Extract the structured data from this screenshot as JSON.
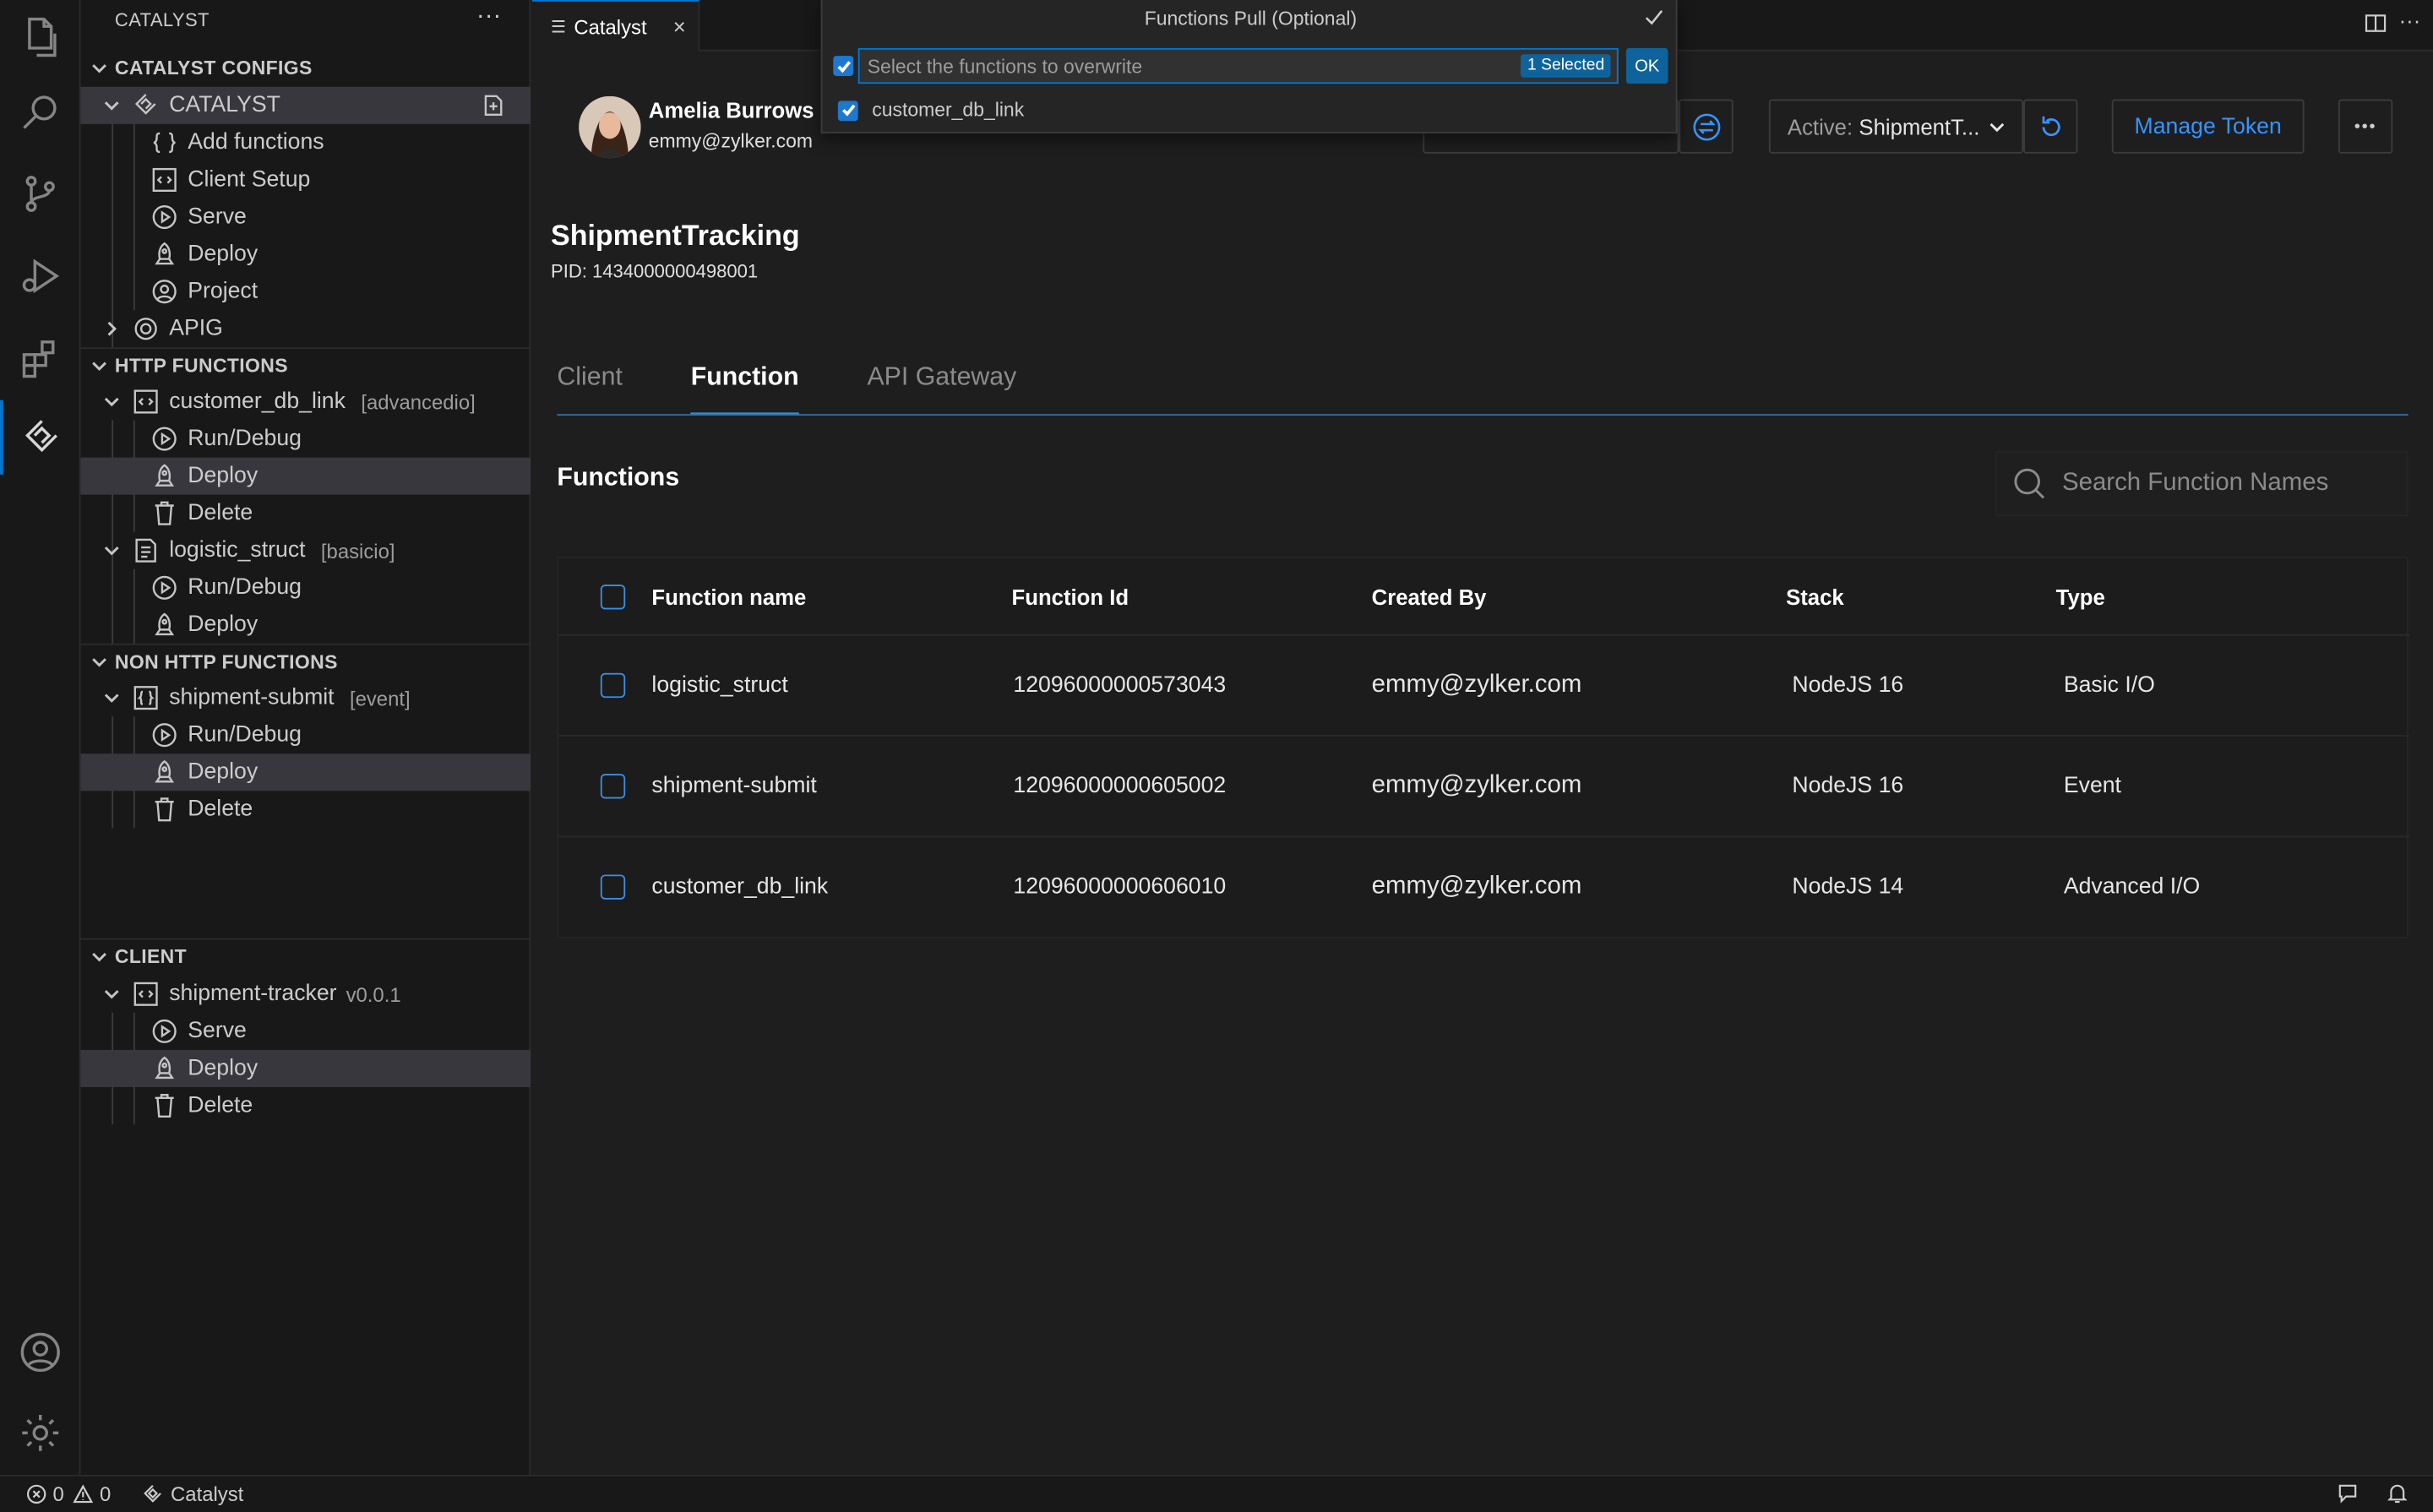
{
  "sidebar": {
    "title": "CATALYST",
    "more": "···",
    "sections": {
      "configs": "CATALYST CONFIGS",
      "http": "HTTP FUNCTIONS",
      "nonhttp": "NON HTTP FUNCTIONS",
      "client": "CLIENT"
    },
    "catalyst_root": "CATALYST",
    "config_items": [
      "Add functions",
      "Client Setup",
      "Serve",
      "Deploy",
      "Project"
    ],
    "apig": "APIG",
    "http_fn1": {
      "name": "customer_db_link",
      "desc": "[advancedio]",
      "items": [
        "Run/Debug",
        "Deploy",
        "Delete"
      ]
    },
    "http_fn2": {
      "name": "logistic_struct",
      "desc": "[basicio]",
      "items": [
        "Run/Debug",
        "Deploy"
      ]
    },
    "nonhttp_fn": {
      "name": "shipment-submit",
      "desc": "[event]",
      "items": [
        "Run/Debug",
        "Deploy",
        "Delete"
      ]
    },
    "client_app": {
      "name": "shipment-tracker",
      "desc": "v0.0.1",
      "items": [
        "Serve",
        "Deploy",
        "Delete"
      ]
    }
  },
  "tab": {
    "label": "Catalyst",
    "close": "×"
  },
  "quickpick": {
    "title": "Functions Pull (Optional)",
    "placeholder": "Select the functions to overwrite",
    "badge": "1 Selected",
    "ok": "OK",
    "items": [
      {
        "label": "customer_db_link",
        "checked": true
      }
    ]
  },
  "user": {
    "name": "Amelia Burrows",
    "email": "emmy@zylker.com"
  },
  "header": {
    "active_label": "Active:",
    "active_value": "ShipmentT...",
    "manage_token": "Manage Token",
    "more": "•••"
  },
  "project": {
    "title": "ShipmentTracking",
    "pid": "PID: 1434000000498001"
  },
  "content_tabs": [
    "Client",
    "Function",
    "API Gateway"
  ],
  "active_tab": "Function",
  "functions": {
    "title": "Functions",
    "search_placeholder": "Search Function Names",
    "columns": [
      "Function name",
      "Function Id",
      "Created By",
      "Stack",
      "Type"
    ],
    "rows": [
      [
        "logistic_struct",
        "12096000000573043",
        "emmy@zylker.com",
        "NodeJS 16",
        "Basic I/O"
      ],
      [
        "shipment-submit",
        "12096000000605002",
        "emmy@zylker.com",
        "NodeJS 16",
        "Event"
      ],
      [
        "customer_db_link",
        "12096000000606010",
        "emmy@zylker.com",
        "NodeJS 14",
        "Advanced I/O"
      ]
    ]
  },
  "status": {
    "errors": "0",
    "warnings": "0",
    "app": "Catalyst"
  },
  "colors": {
    "accent": "#0078d4",
    "link": "#2f8fd8",
    "background": "#1e1e1e",
    "sidebar": "#181818"
  }
}
